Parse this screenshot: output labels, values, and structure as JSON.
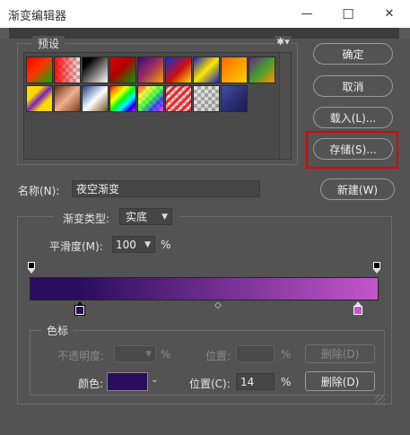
{
  "window": {
    "title": "渐变编辑器",
    "minimize_glyph": "—",
    "maximize_glyph": "☐",
    "close_glyph": "✕"
  },
  "presets": {
    "legend": "预设",
    "gear_glyph": "✱▾",
    "swatches": [
      {
        "name": "red-green",
        "bg": "linear-gradient(135deg,#ff0000 0%,#ff3300 45%,#00b000 100%)"
      },
      {
        "name": "red-transparent",
        "bg": "linear-gradient(90deg,rgba(255,0,0,0.95),rgba(255,0,0,0.1))",
        "checker": true
      },
      {
        "name": "black-white",
        "bg": "linear-gradient(135deg,#000 0%,#000 20%,#fff 100%)"
      },
      {
        "name": "red-green-2",
        "bg": "linear-gradient(135deg,#e00000 0%,#b00000 45%,#00a000 100%)"
      },
      {
        "name": "violet-orange",
        "bg": "linear-gradient(135deg,#3a0a7a 0%,#a03060 50%,#ffa000 100%)"
      },
      {
        "name": "blue-red-yellow",
        "bg": "linear-gradient(135deg,#1030d0 0%,#d01010 55%,#ffe000 100%)"
      },
      {
        "name": "blue-yellow-blue",
        "bg": "linear-gradient(135deg,#1020c0 0%,#ffe800 50%,#1020c0 100%)"
      },
      {
        "name": "orange-yellow",
        "bg": "linear-gradient(135deg,#ff6a00 0%,#ffd000 100%)"
      },
      {
        "name": "violet-green-orange",
        "bg": "linear-gradient(135deg,#702090 0%,#40a030 50%,#ff9000 100%)"
      },
      {
        "name": "yellow-violet-stripe",
        "bg": "linear-gradient(135deg,#ffd800 0%,#ffd800 30%,#7a20c0 50%,#ffd800 70%,#ffd800 100%)"
      },
      {
        "name": "copper",
        "bg": "linear-gradient(135deg,#6a3010 0%,#f0b090 50%,#7a3a14 100%)"
      },
      {
        "name": "chrome",
        "bg": "linear-gradient(135deg,#204080 0%,#e8f0ff 48%,#ffffff 52%,#705020 100%)"
      },
      {
        "name": "spectrum",
        "bg": "linear-gradient(135deg,#ff0000,#ff9900,#ffff00,#00ff00,#00ffff,#0000ff,#ff00ff)"
      },
      {
        "name": "transparent-rainbow",
        "bg": "linear-gradient(135deg,rgba(255,0,0,0.7),rgba(255,255,0,0.7),rgba(0,255,0,0.7),rgba(0,0,255,0.7),rgba(255,0,255,0.7))",
        "checker": true
      },
      {
        "name": "transparent-stripes",
        "bg": "repeating-linear-gradient(135deg,#ff2020 0px,#ff2020 3px,transparent 3px,transparent 6px)",
        "checker": true
      },
      {
        "name": "neutral-density",
        "bg": "linear-gradient(135deg,rgba(0,0,0,0.1),rgba(0,0,0,0.2))",
        "checker": true
      },
      {
        "name": "night-sky",
        "bg": "linear-gradient(135deg,#4050a0 0%,#2a2a70 60%,#1a1a50 100%)"
      }
    ]
  },
  "buttons": {
    "ok": "确定",
    "cancel": "取消",
    "load": "载入(L)...",
    "save": "存储(S)...",
    "new": "新建(W)"
  },
  "name": {
    "label": "名称(N):",
    "value": "夜空渐变"
  },
  "gradient_type": {
    "label": "渐变类型:",
    "value": "实底"
  },
  "smoothness": {
    "label": "平滑度(M):",
    "value": "100",
    "unit": "%"
  },
  "gradient": {
    "start_color": "#2a0d5e",
    "end_color": "#c455cc",
    "midpoint_glyph": "◇"
  },
  "color_stops": {
    "legend": "色标",
    "opacity_label": "不透明度:",
    "opacity_unit": "%",
    "opacity_location_label": "位置:",
    "opacity_location_unit": "%",
    "opacity_delete": "删除(D)",
    "color_label": "颜色:",
    "color_value": "#2a0d5e",
    "location_label": "位置(C):",
    "location_value": "14",
    "location_unit": "%",
    "delete": "删除(D)"
  },
  "highlight_color": "#e00000"
}
